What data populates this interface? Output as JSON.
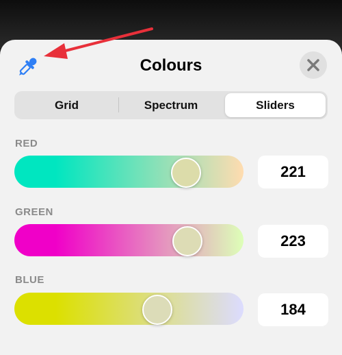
{
  "header": {
    "title": "Colours"
  },
  "icons": {
    "eyedropper": "eyedropper-icon",
    "close": "close-icon",
    "annotation_arrow": "arrow-icon"
  },
  "tabs": [
    {
      "label": "Grid",
      "selected": false
    },
    {
      "label": "Spectrum",
      "selected": false
    },
    {
      "label": "Sliders",
      "selected": true
    }
  ],
  "sliders": [
    {
      "label": "RED",
      "value": "221",
      "fraction": 221,
      "max": 255,
      "thumb_color": "#dcdcaa",
      "track_start": "#00e6c0",
      "track_end": "#ffdcb0"
    },
    {
      "label": "GREEN",
      "value": "223",
      "fraction": 223,
      "max": 255,
      "thumb_color": "#dddcb5",
      "track_start": "#f000c8",
      "track_end": "#ddffb8"
    },
    {
      "label": "BLUE",
      "value": "184",
      "fraction": 184,
      "max": 255,
      "thumb_color": "#dcdcb8",
      "track_start": "#dce000",
      "track_end": "#dcdcff"
    }
  ],
  "colors": {
    "accent_blue": "#2f7ff5",
    "annotation_red": "#e8303a"
  }
}
